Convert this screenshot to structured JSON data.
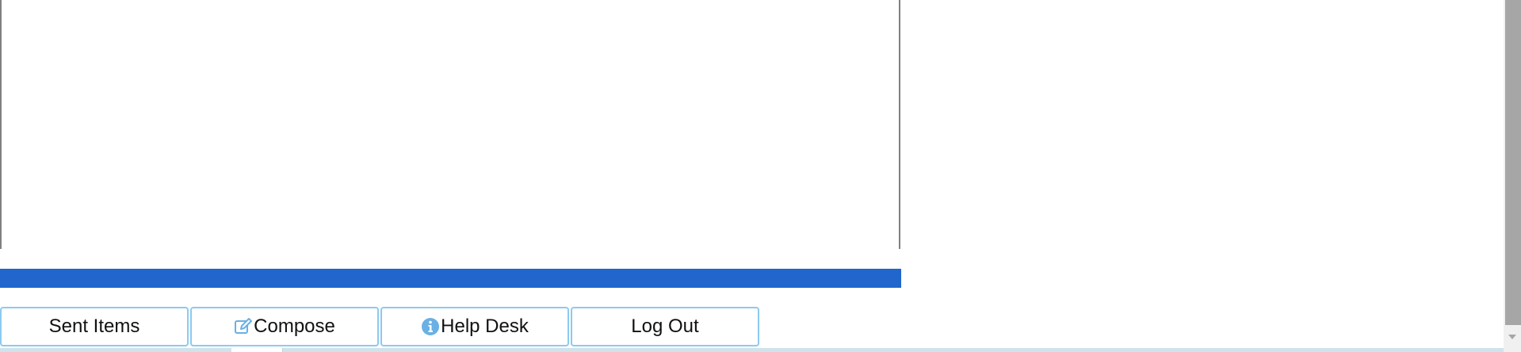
{
  "nav_buttons": [
    {
      "label": "Sent Items",
      "icon": ""
    },
    {
      "label": "Compose",
      "icon": "compose-icon"
    },
    {
      "label": "Help Desk",
      "icon": "info-icon"
    },
    {
      "label": "Log Out",
      "icon": ""
    }
  ],
  "colors": {
    "blue_bar": "#2066cc",
    "button_border": "#8ccaf0",
    "icon_blue": "#6ab0e4",
    "scrollbar_thumb": "#a6a6a6",
    "bottom_strip": "#cfe3ea"
  }
}
